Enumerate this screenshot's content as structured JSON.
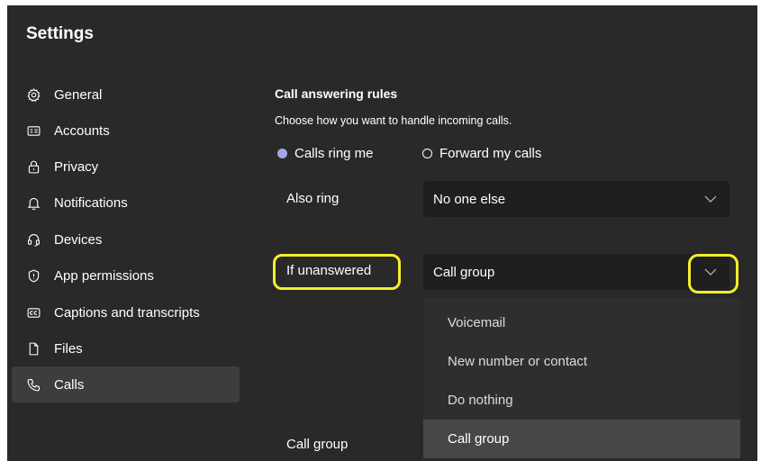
{
  "window": {
    "title": "Settings"
  },
  "sidebar": {
    "items": [
      {
        "label": "General",
        "icon": "gear-icon"
      },
      {
        "label": "Accounts",
        "icon": "id-card-icon"
      },
      {
        "label": "Privacy",
        "icon": "lock-icon"
      },
      {
        "label": "Notifications",
        "icon": "bell-icon"
      },
      {
        "label": "Devices",
        "icon": "headset-icon"
      },
      {
        "label": "App permissions",
        "icon": "shield-icon"
      },
      {
        "label": "Captions and transcripts",
        "icon": "closed-captions-icon"
      },
      {
        "label": "Files",
        "icon": "file-icon"
      },
      {
        "label": "Calls",
        "icon": "phone-icon",
        "active": true
      }
    ]
  },
  "main": {
    "section_title": "Call answering rules",
    "section_desc": "Choose how you want to handle incoming calls.",
    "radios": [
      {
        "label": "Calls ring me",
        "checked": true
      },
      {
        "label": "Forward my calls",
        "checked": false
      }
    ],
    "also_ring": {
      "label": "Also ring",
      "value": "No one else"
    },
    "if_unanswered": {
      "label": "If unanswered",
      "value": "Call group",
      "options": [
        "Voicemail",
        "New number or contact",
        "Do nothing",
        "Call group"
      ],
      "selected_option": "Call group"
    },
    "call_group_label": "Call group"
  },
  "colors": {
    "background": "#292929",
    "highlight": "#f5ef2a",
    "radio_accent": "#a3a7e6"
  }
}
